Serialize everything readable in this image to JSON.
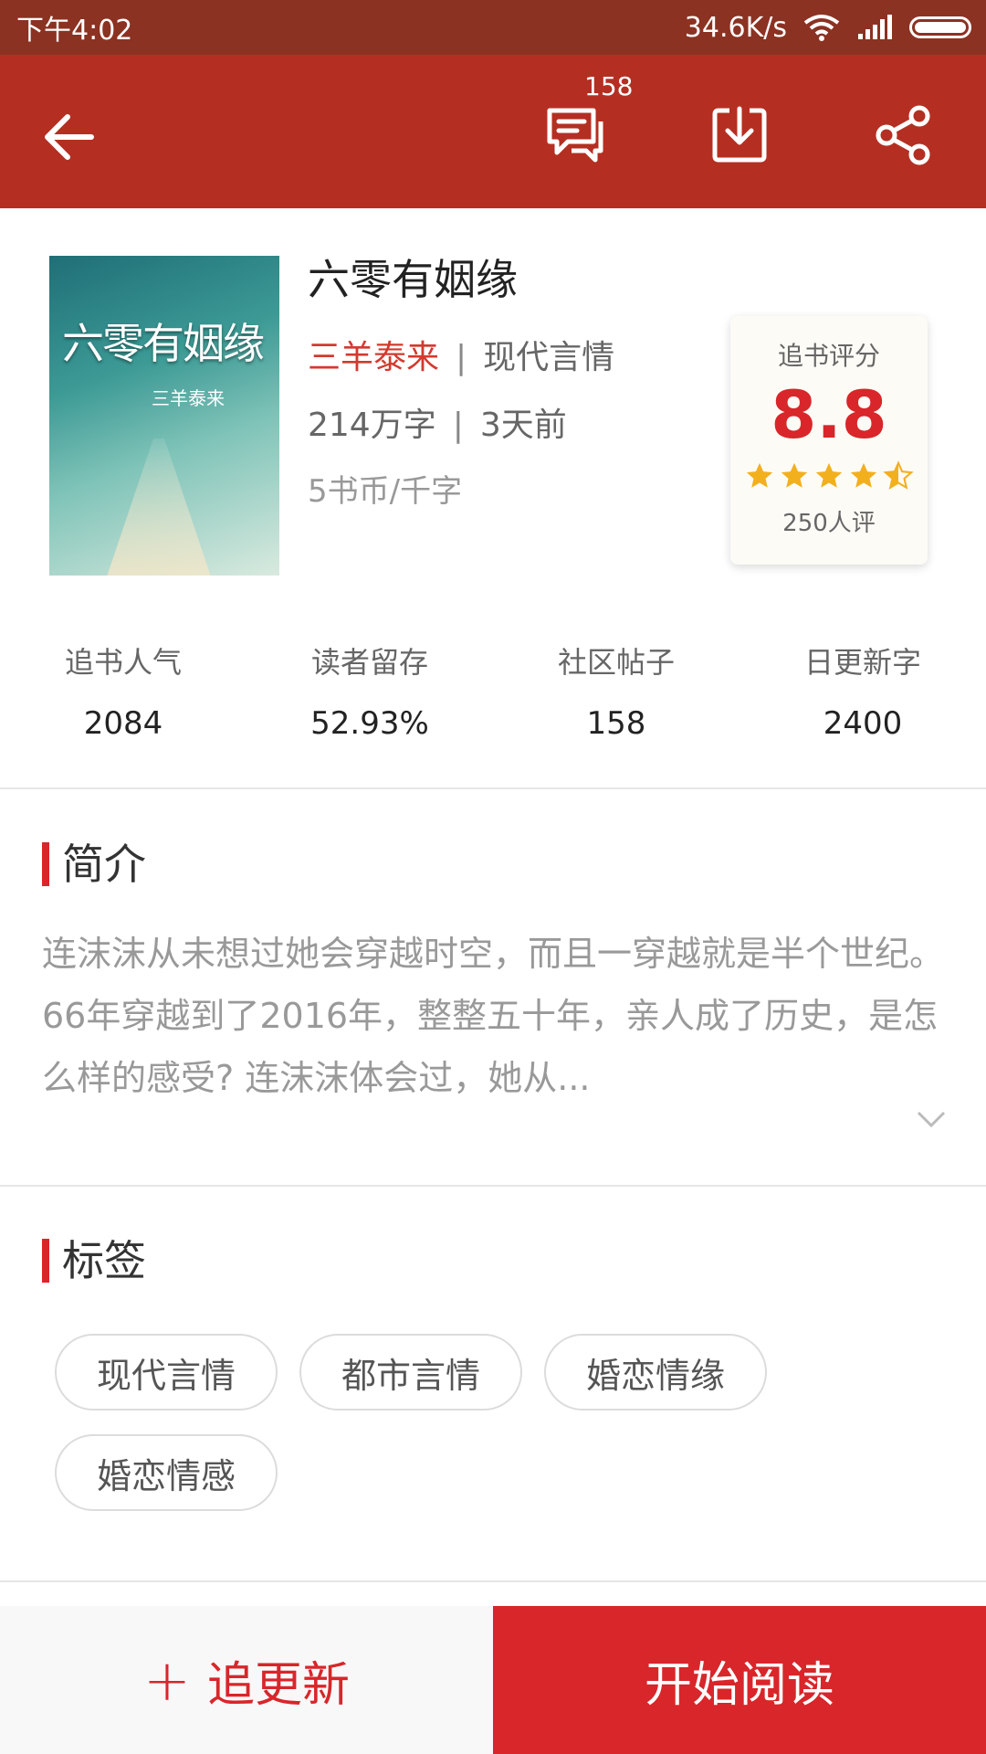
{
  "status_bar": {
    "time": "下午4:02",
    "speed": "34.6K/s"
  },
  "toolbar": {
    "comment_count": "158",
    "icons": [
      "back-arrow-icon",
      "comment-icon",
      "download-icon",
      "share-icon"
    ]
  },
  "book": {
    "cover_title": "六零有姻缘",
    "cover_author": "三羊泰来",
    "title": "六零有姻缘",
    "author": "三羊泰来",
    "category": "现代言情",
    "word_count": "214万字",
    "updated": "3天前",
    "price": "5书币/千字"
  },
  "rating": {
    "label": "追书评分",
    "score": "8.8",
    "stars": 4.5,
    "count": "250人评"
  },
  "stats": [
    {
      "label": "追书人气",
      "value": "2084"
    },
    {
      "label": "读者留存",
      "value": "52.93%"
    },
    {
      "label": "社区帖子",
      "value": "158"
    },
    {
      "label": "日更新字",
      "value": "2400"
    }
  ],
  "intro": {
    "title": "简介",
    "text": "连沫沫从未想过她会穿越时空，而且一穿越就是半个世纪。66年穿越到了2016年，整整五十年，亲人成了历史，是怎么样的感受? 连沫沫体会过，她从..."
  },
  "tags": {
    "title": "标签",
    "items": [
      "现代言情",
      "都市言情",
      "婚恋情缘",
      "婚恋情感"
    ]
  },
  "bottom": {
    "follow_plus": "+",
    "follow_label": "追更新",
    "read_label": "开始阅读"
  },
  "colors": {
    "accent": "#d8262a",
    "toolbar": "#b42f22",
    "status_bar": "#8b3222",
    "star": "#f2b01e"
  }
}
